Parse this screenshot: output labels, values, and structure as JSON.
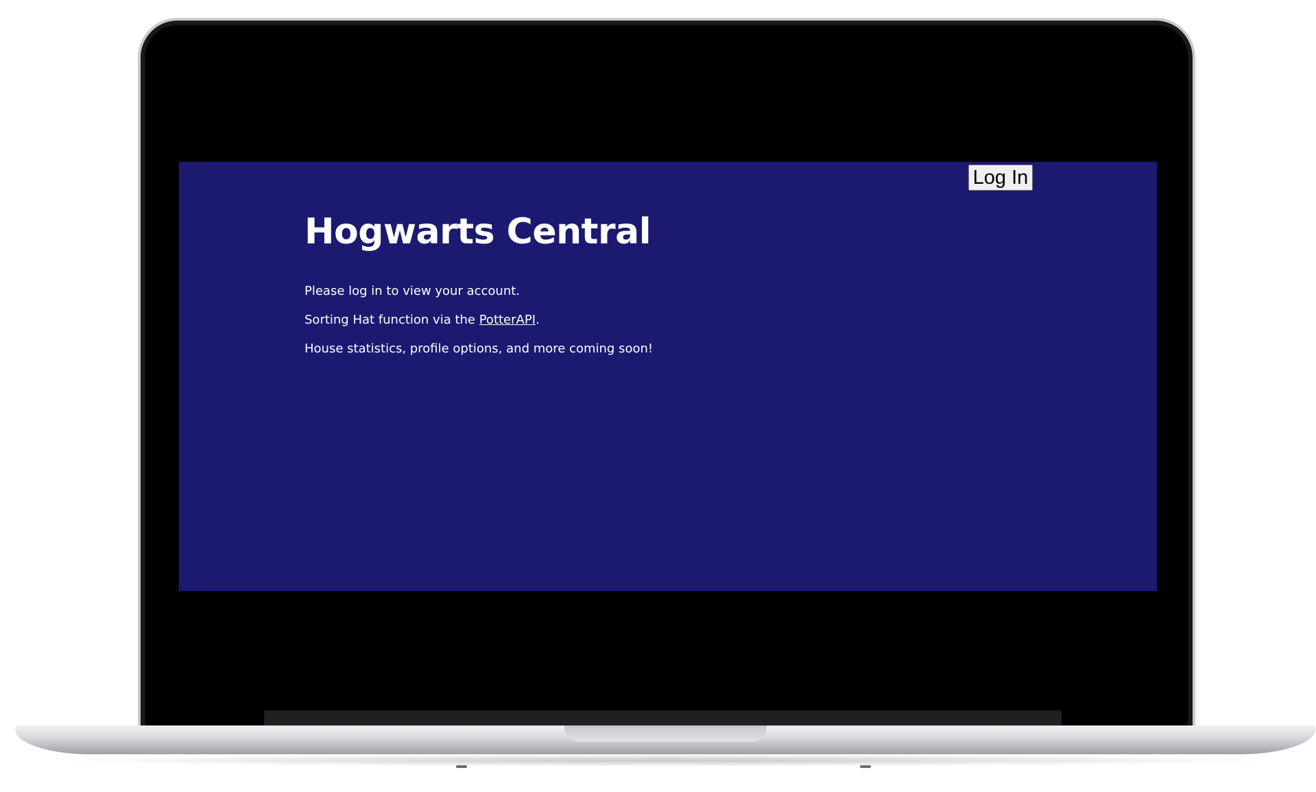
{
  "header": {
    "login_button_label": "Log In"
  },
  "main": {
    "title": "Hogwarts Central",
    "login_prompt": "Please log in to view your account.",
    "sorting_prefix": "Sorting Hat function via the ",
    "sorting_link_text": "PotterAPI",
    "sorting_suffix": ".",
    "coming_soon": "House statistics, profile options, and more coming soon!"
  },
  "colors": {
    "page_background": "#1b1a70",
    "text": "#ffffff",
    "device_bezel": "#000000"
  }
}
